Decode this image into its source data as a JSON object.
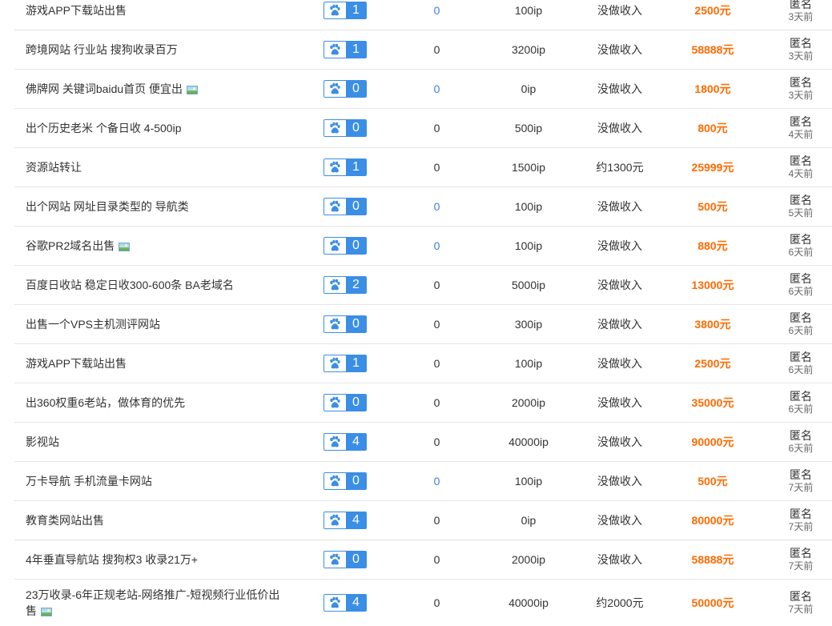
{
  "rows": [
    {
      "title": "游戏APP下载站出售",
      "has_image": false,
      "baidu": "1",
      "links": "0",
      "ip": "100ip",
      "income": "没做收入",
      "price": "2500元",
      "author": "匿名",
      "time": "3天前"
    },
    {
      "title": "跨境网站 行业站 搜狗收录百万",
      "has_image": false,
      "baidu": "1",
      "links": "0",
      "ip": "3200ip",
      "income": "没做收入",
      "price": "58888元",
      "author": "匿名",
      "time": "3天前"
    },
    {
      "title": "佛牌网 关键词baidu首页 便宜出",
      "has_image": true,
      "baidu": "0",
      "links": "0",
      "ip": "0ip",
      "income": "没做收入",
      "price": "1800元",
      "author": "匿名",
      "time": "3天前"
    },
    {
      "title": "出个历史老米 个备日收 4-500ip",
      "has_image": false,
      "baidu": "0",
      "links": "0",
      "ip": "500ip",
      "income": "没做收入",
      "price": "800元",
      "author": "匿名",
      "time": "4天前"
    },
    {
      "title": "资源站转让",
      "has_image": false,
      "baidu": "1",
      "links": "0",
      "ip": "1500ip",
      "income": "约1300元",
      "price": "25999元",
      "author": "匿名",
      "time": "4天前"
    },
    {
      "title": "出个网站 网址目录类型的 导航类",
      "has_image": false,
      "baidu": "0",
      "links": "0",
      "ip": "100ip",
      "income": "没做收入",
      "price": "500元",
      "author": "匿名",
      "time": "5天前"
    },
    {
      "title": "谷歌PR2域名出售",
      "has_image": true,
      "baidu": "0",
      "links": "0",
      "ip": "100ip",
      "income": "没做收入",
      "price": "880元",
      "author": "匿名",
      "time": "6天前"
    },
    {
      "title": "百度日收站 稳定日收300-600条 BA老域名",
      "has_image": false,
      "baidu": "2",
      "links": "0",
      "ip": "5000ip",
      "income": "没做收入",
      "price": "13000元",
      "author": "匿名",
      "time": "6天前"
    },
    {
      "title": "出售一个VPS主机测评网站",
      "has_image": false,
      "baidu": "0",
      "links": "0",
      "ip": "300ip",
      "income": "没做收入",
      "price": "3800元",
      "author": "匿名",
      "time": "6天前"
    },
    {
      "title": "游戏APP下载站出售",
      "has_image": false,
      "baidu": "1",
      "links": "0",
      "ip": "100ip",
      "income": "没做收入",
      "price": "2500元",
      "author": "匿名",
      "time": "6天前"
    },
    {
      "title": "出360权重6老站，做体育的优先",
      "has_image": false,
      "baidu": "0",
      "links": "0",
      "ip": "2000ip",
      "income": "没做收入",
      "price": "35000元",
      "author": "匿名",
      "time": "6天前"
    },
    {
      "title": "影视站",
      "has_image": false,
      "baidu": "4",
      "links": "0",
      "ip": "40000ip",
      "income": "没做收入",
      "price": "90000元",
      "author": "匿名",
      "time": "6天前"
    },
    {
      "title": "万卡导航 手机流量卡网站",
      "has_image": false,
      "baidu": "0",
      "links": "0",
      "ip": "100ip",
      "income": "没做收入",
      "price": "500元",
      "author": "匿名",
      "time": "7天前"
    },
    {
      "title": "教育类网站出售",
      "has_image": false,
      "baidu": "4",
      "links": "0",
      "ip": "0ip",
      "income": "没做收入",
      "price": "80000元",
      "author": "匿名",
      "time": "7天前"
    },
    {
      "title": "4年垂直导航站 搜狗权3 收录21万+",
      "has_image": false,
      "baidu": "0",
      "links": "0",
      "ip": "2000ip",
      "income": "没做收入",
      "price": "58888元",
      "author": "匿名",
      "time": "7天前"
    },
    {
      "title": "23万收录-6年正规老站-网络推广-短视频行业低价出售",
      "has_image": true,
      "baidu": "4",
      "links": "0",
      "ip": "40000ip",
      "income": "约2000元",
      "price": "50000元",
      "author": "匿名",
      "time": "7天前"
    }
  ],
  "blue_link_rows": [
    0,
    2,
    5,
    6,
    12
  ],
  "colors": {
    "baidu_blue": "#3a8ee6",
    "price_orange": "#ff6a00",
    "link_blue": "#3a7fd5"
  },
  "icons": {
    "baidu": "baidu-paw-icon",
    "image": "image-icon"
  }
}
